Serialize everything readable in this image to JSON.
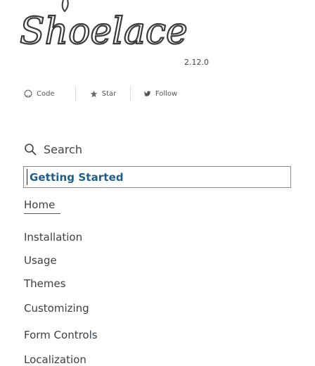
{
  "brand": {
    "logo_text": "Shoelace",
    "version": "2.12.0",
    "brand_color": "#3b3b3b"
  },
  "badges": [
    {
      "label": "Code",
      "icon": "github-icon"
    },
    {
      "label": "Star",
      "icon": "star-icon"
    },
    {
      "label": "Follow",
      "icon": "twitter-icon"
    }
  ],
  "search": {
    "label": "Search",
    "icon": "search-icon"
  },
  "sidebar": {
    "section_title": "Getting Started",
    "section_color": "#1e5f8a",
    "items": [
      {
        "label": "Home"
      },
      {
        "label": "Installation"
      },
      {
        "label": "Usage"
      },
      {
        "label": "Themes"
      },
      {
        "label": "Customizing"
      },
      {
        "label": "Form Controls"
      },
      {
        "label": "Localization"
      }
    ]
  }
}
